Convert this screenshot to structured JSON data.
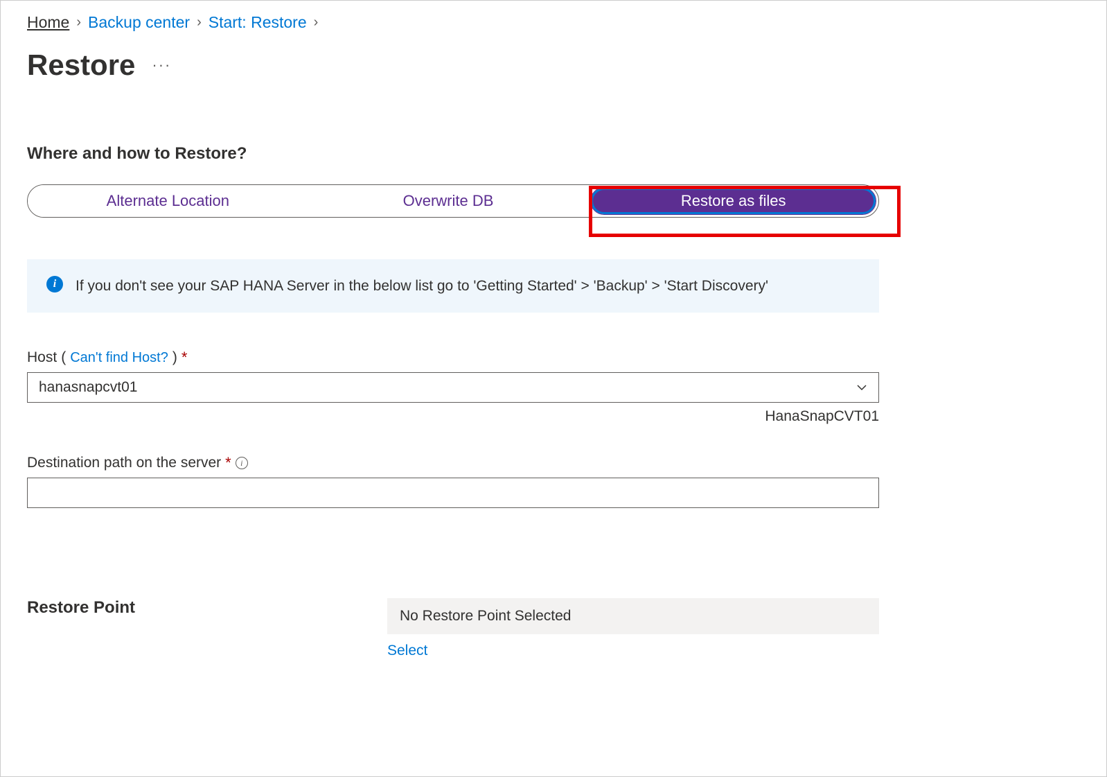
{
  "breadcrumb": {
    "home": "Home",
    "backup_center": "Backup center",
    "start_restore": "Start: Restore"
  },
  "page_title": "Restore",
  "section_title": "Where and how to Restore?",
  "pills": {
    "alternate": "Alternate Location",
    "overwrite": "Overwrite DB",
    "restore_files": "Restore as files"
  },
  "info_banner": "If you don't see your SAP HANA Server in the below list go to 'Getting Started' > 'Backup' > 'Start Discovery'",
  "host": {
    "label": "Host",
    "help_link": "Can't find Host?",
    "value": "hanasnapcvt01",
    "hint": "HanaSnapCVT01"
  },
  "destination": {
    "label": "Destination path on the server",
    "value": ""
  },
  "restore_point": {
    "label": "Restore Point",
    "value": "No Restore Point Selected",
    "select_link": "Select"
  }
}
